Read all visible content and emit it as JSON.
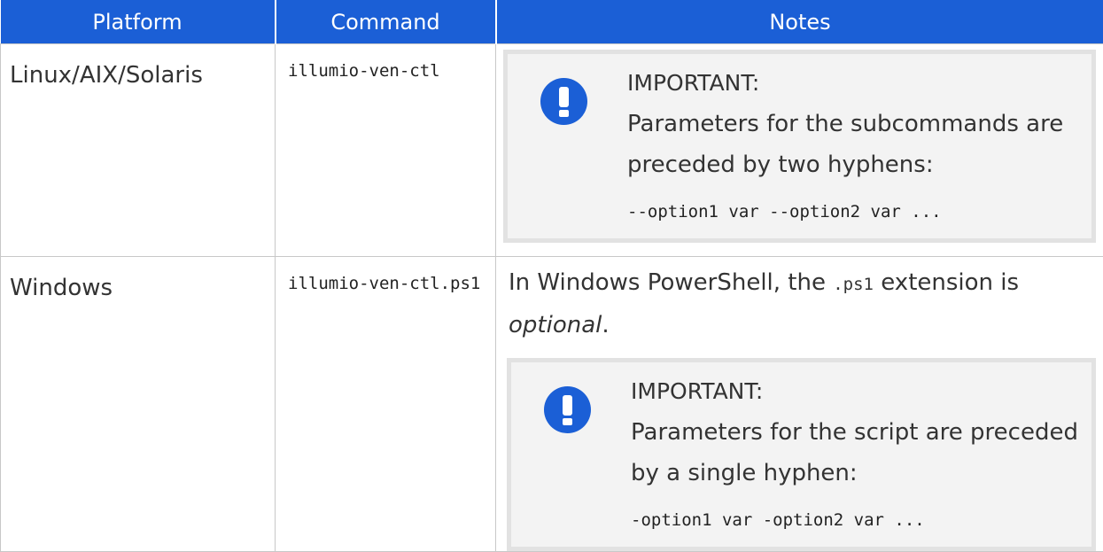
{
  "table": {
    "headers": [
      "Platform",
      "Command",
      "Notes"
    ],
    "rows": [
      {
        "platform": "Linux/AIX/Solaris",
        "command": "illumio-ven-ctl",
        "note": {
          "label": "IMPORTANT:",
          "text": "Parameters for the subcommands are preceded by two hyphens:",
          "code": "--option1 var --option2 var ..."
        }
      },
      {
        "platform": "Windows",
        "command": "illumio-ven-ctl.ps1",
        "lead": {
          "before": "In Windows PowerShell, the ",
          "code": ".ps1",
          "after": " extension is ",
          "emphasis": "optional",
          "end": "."
        },
        "note": {
          "label": "IMPORTANT:",
          "text": "Parameters for the script are preceded by a single hyphen:",
          "code": "-option1 var -option2 var ..."
        }
      }
    ]
  },
  "colors": {
    "header_bg": "#1b5fd6",
    "icon": "#1b5fd6",
    "callout_bg": "#f3f3f3",
    "callout_border": "#e2e2e2"
  },
  "icons": [
    "exclamation-icon"
  ]
}
